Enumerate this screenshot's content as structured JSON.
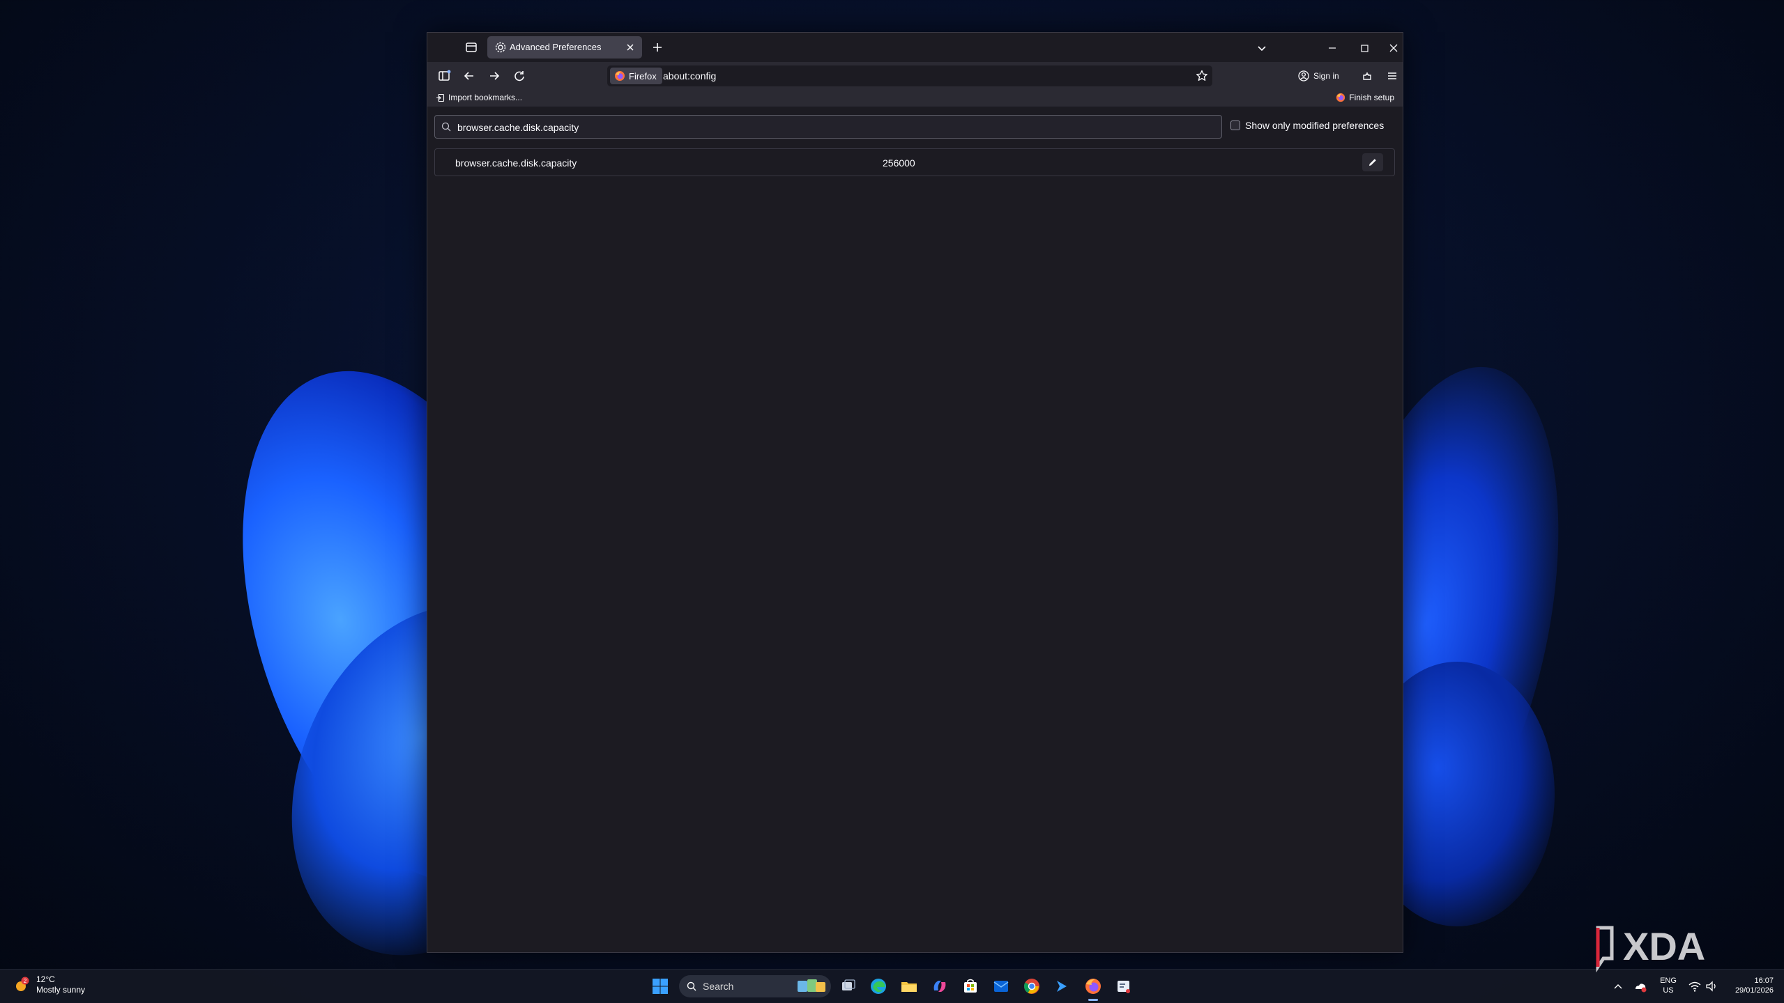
{
  "browser": {
    "tab": {
      "title": "Advanced Preferences"
    },
    "urlbar": {
      "identity_label": "Firefox",
      "url": "about:config"
    },
    "account": {
      "sign_in_label": "Sign in"
    },
    "bookmarks": {
      "import_label": "Import bookmarks...",
      "finish_setup_label": "Finish setup"
    }
  },
  "config": {
    "search_value": "browser.cache.disk.capacity",
    "modified_only_label": "Show only modified preferences",
    "modified_only_checked": false,
    "preferences": [
      {
        "name": "browser.cache.disk.capacity",
        "value": "256000"
      }
    ]
  },
  "taskbar": {
    "weather": {
      "temperature": "12°C",
      "condition": "Mostly sunny",
      "badge": "2"
    },
    "search_label": "Search",
    "language": {
      "primary": "ENG",
      "secondary": "US"
    },
    "clock": {
      "time": "16:07",
      "date": "29/01/2026"
    },
    "pinned_icons": [
      "windows-start-icon",
      "search-icon",
      "task-view-icon",
      "edge-icon",
      "file-explorer-icon",
      "copilot-icon",
      "microsoft-store-icon",
      "outlook-icon",
      "chrome-icon",
      "terminal-icon",
      "firefox-icon",
      "snipping-tool-icon"
    ]
  },
  "watermark": {
    "text": "XDA"
  },
  "colors": {
    "window_bg": "#1c1b22",
    "toolbar_bg": "#2b2a33",
    "tab_active_bg": "#42414d",
    "text": "#fbfbfe",
    "accent": "#8ab4ff"
  }
}
